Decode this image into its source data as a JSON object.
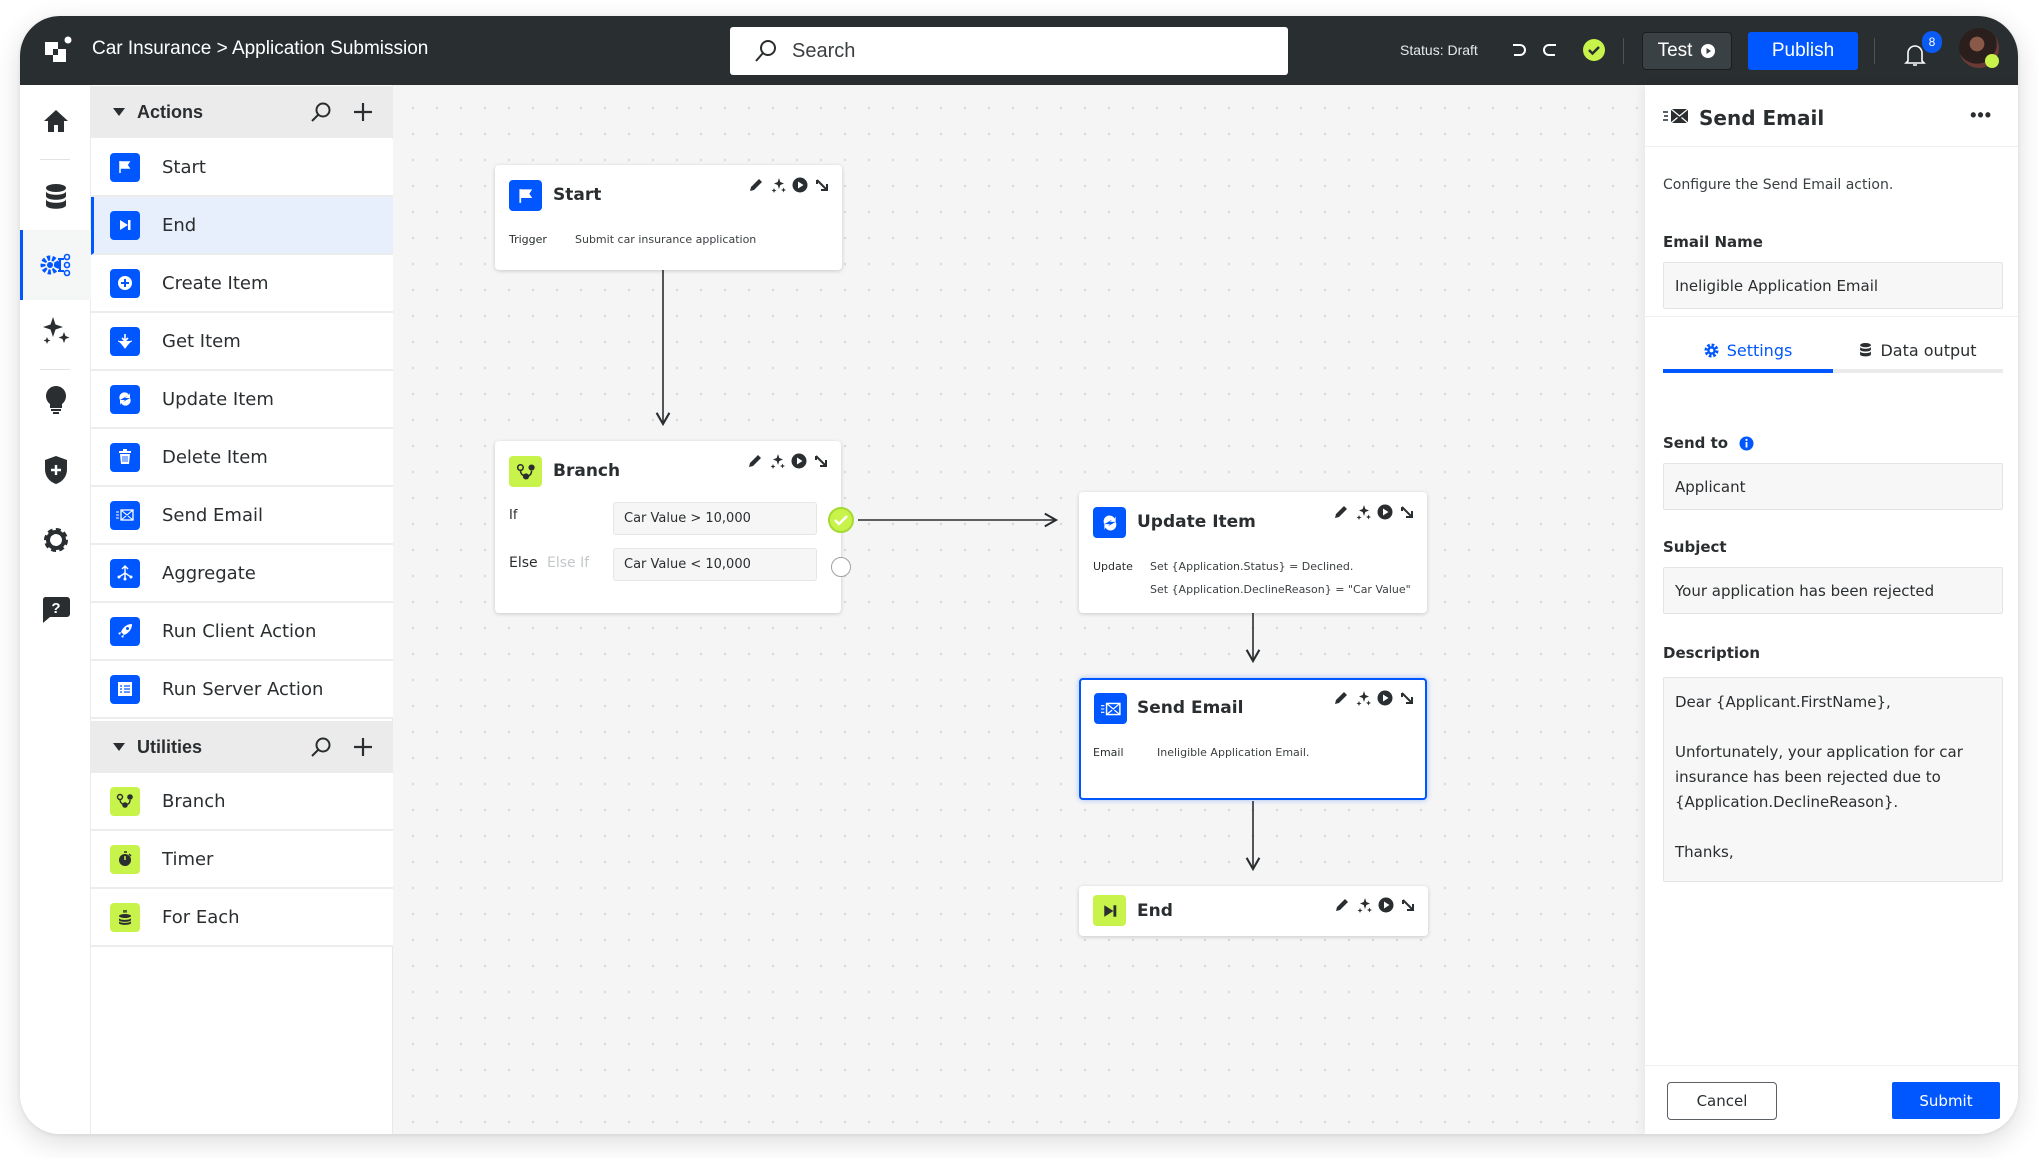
{
  "header": {
    "breadcrumb": "Car Insurance > Application Submission",
    "search_placeholder": "Search",
    "status": "Status: Draft",
    "test_label": "Test",
    "publish_label": "Publish",
    "notification_count": "8"
  },
  "rail": {
    "items": [
      {
        "name": "home",
        "icon": "home-icon"
      },
      {
        "name": "data",
        "icon": "database-icon"
      },
      {
        "name": "logic",
        "icon": "gear-circuit-icon",
        "active": true
      },
      {
        "name": "ai",
        "icon": "sparkles-icon"
      },
      {
        "name": "ideas",
        "icon": "lightbulb-icon"
      },
      {
        "name": "security",
        "icon": "shield-plus-icon"
      },
      {
        "name": "settings",
        "icon": "gear-icon"
      },
      {
        "name": "help",
        "icon": "help-chat-icon"
      }
    ]
  },
  "actions_panel": {
    "actions_title": "Actions",
    "actions": [
      {
        "label": "Start",
        "icon": "flag-icon"
      },
      {
        "label": "End",
        "icon": "skip-end-icon",
        "selected": true
      },
      {
        "label": "Create Item",
        "icon": "plus-circle-icon"
      },
      {
        "label": "Get Item",
        "icon": "hands-download-icon"
      },
      {
        "label": "Update Item",
        "icon": "refresh-icon"
      },
      {
        "label": "Delete Item",
        "icon": "trash-icon"
      },
      {
        "label": "Send Email",
        "icon": "email-send-icon"
      },
      {
        "label": "Aggregate",
        "icon": "aggregate-icon"
      },
      {
        "label": "Run Client Action",
        "icon": "rocket-icon"
      },
      {
        "label": "Run Server Action",
        "icon": "server-icon"
      }
    ],
    "utilities_title": "Utilities",
    "utilities": [
      {
        "label": "Branch",
        "icon": "branch-icon"
      },
      {
        "label": "Timer",
        "icon": "timer-icon"
      },
      {
        "label": "For Each",
        "icon": "stack-loop-icon"
      }
    ]
  },
  "flow": {
    "start": {
      "title": "Start",
      "key": "Trigger",
      "value": "Submit car insurance application"
    },
    "branch": {
      "title": "Branch",
      "if_label": "If",
      "if_condition": "Car Value > 10,000",
      "else_label": "Else",
      "else_if_label": "Else If",
      "else_condition": "Car Value < 10,000"
    },
    "update": {
      "title": "Update Item",
      "key": "Update",
      "line1": "Set {Application.Status} = Declined.",
      "line2": "Set {Application.DeclineReason} = \"Car Value\""
    },
    "email": {
      "title": "Send Email",
      "key": "Email",
      "value": "Ineligible Application Email."
    },
    "end": {
      "title": "End"
    }
  },
  "details_panel": {
    "title": "Send Email",
    "description": "Configure the Send Email action.",
    "email_name_label": "Email Name",
    "email_name_value": "Ineligible Application Email",
    "tabs": [
      {
        "label": "Settings",
        "active": true
      },
      {
        "label": "Data output",
        "active": false
      }
    ],
    "send_to_label": "Send to",
    "send_to_value": "Applicant",
    "subject_label": "Subject",
    "subject_value": "Your application has been rejected",
    "body_label": "Description",
    "body_value": "Dear {Applicant.FirstName},\n\nUnfortunately, your application for car insurance has been rejected due to {Application.DeclineReason}.\n\nThanks,",
    "cancel_label": "Cancel",
    "submit_label": "Submit"
  },
  "colors": {
    "accent": "#0057ff",
    "lime": "#c7f34a",
    "header_bg": "#292f31",
    "text": "#2a2e30"
  }
}
